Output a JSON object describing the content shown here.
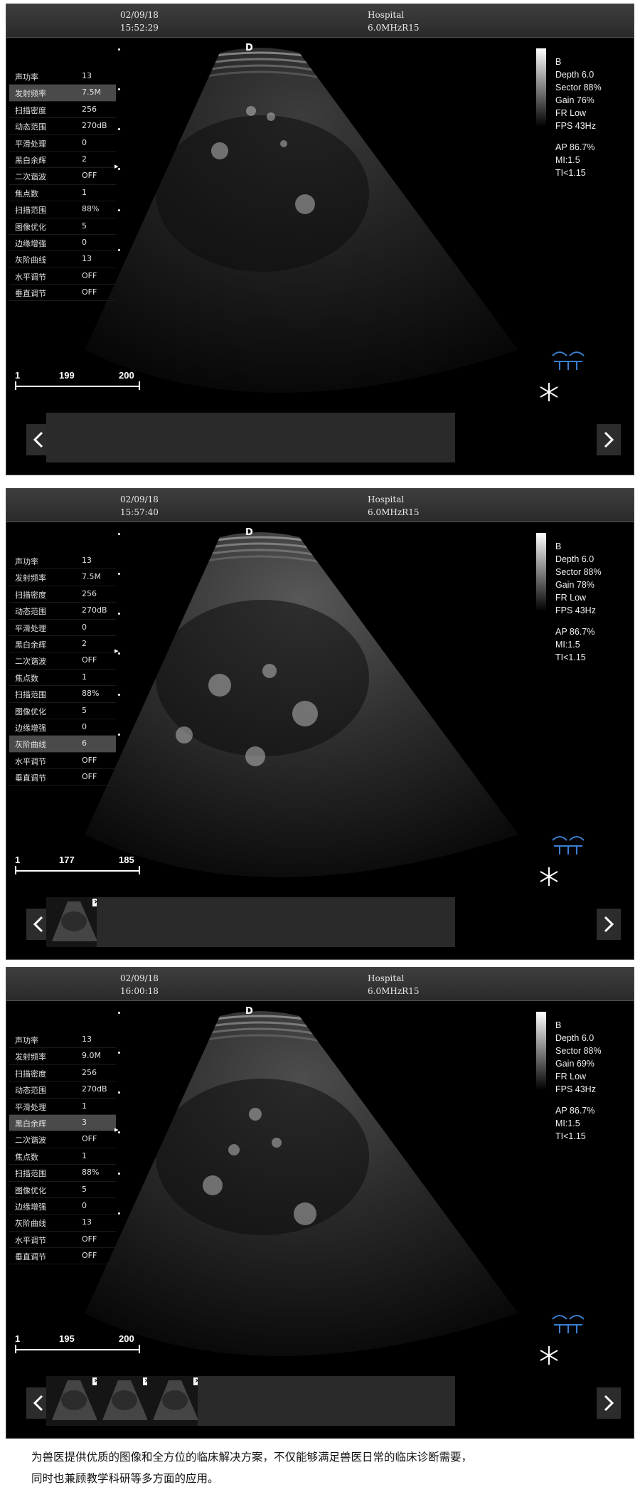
{
  "panels": [
    {
      "date": "02/09/18",
      "time": "15:52:29",
      "hospital": "Hospital",
      "freq": "6.0MHzR15",
      "depth_marker": "D",
      "params": [
        {
          "label": "声功率",
          "value": "13"
        },
        {
          "label": "发射频率",
          "value": "7.5M"
        },
        {
          "label": "扫描密度",
          "value": "256"
        },
        {
          "label": "动态范围",
          "value": "270dB"
        },
        {
          "label": "平滑处理",
          "value": "0"
        },
        {
          "label": "黑白余辉",
          "value": "2"
        },
        {
          "label": "二次谐波",
          "value": "OFF"
        },
        {
          "label": "焦点数",
          "value": "1"
        },
        {
          "label": "扫描范围",
          "value": "88%"
        },
        {
          "label": "图像优化",
          "value": "5"
        },
        {
          "label": "边缘增强",
          "value": "0"
        },
        {
          "label": "灰阶曲线",
          "value": "13"
        },
        {
          "label": "水平调节",
          "value": "OFF"
        },
        {
          "label": "垂直调节",
          "value": "OFF"
        }
      ],
      "selected_param": 1,
      "info": {
        "mode": "B",
        "depth": "Depth 6.0",
        "sector": "Sector 88%",
        "gain": "Gain 76%",
        "fr": "FR Low",
        "fps": "FPS 43Hz",
        "ap": "AP 86.7%",
        "mi": "MI:1.5",
        "ti": "TI<1.15"
      },
      "scale": {
        "start": "1",
        "current": "199",
        "end": "200"
      },
      "thumbnails_filled": 0
    },
    {
      "date": "02/09/18",
      "time": "15:57:40",
      "hospital": "Hospital",
      "freq": "6.0MHzR15",
      "depth_marker": "D",
      "params": [
        {
          "label": "声功率",
          "value": "13"
        },
        {
          "label": "发射频率",
          "value": "7.5M"
        },
        {
          "label": "扫描密度",
          "value": "256"
        },
        {
          "label": "动态范围",
          "value": "270dB"
        },
        {
          "label": "平滑处理",
          "value": "0"
        },
        {
          "label": "黑白余辉",
          "value": "2"
        },
        {
          "label": "二次谐波",
          "value": "OFF"
        },
        {
          "label": "焦点数",
          "value": "1"
        },
        {
          "label": "扫描范围",
          "value": "88%"
        },
        {
          "label": "图像优化",
          "value": "5"
        },
        {
          "label": "边缘增强",
          "value": "0"
        },
        {
          "label": "灰阶曲线",
          "value": "6"
        },
        {
          "label": "水平调节",
          "value": "OFF"
        },
        {
          "label": "垂直调节",
          "value": "OFF"
        }
      ],
      "selected_param": 11,
      "info": {
        "mode": "B",
        "depth": "Depth 6.0",
        "sector": "Sector 88%",
        "gain": "Gain 78%",
        "fr": "FR Low",
        "fps": "FPS 43Hz",
        "ap": "AP 86.7%",
        "mi": "MI:1.5",
        "ti": "TI<1.15"
      },
      "scale": {
        "start": "1",
        "current": "177",
        "end": "185"
      },
      "thumbnails_filled": 1
    },
    {
      "date": "02/09/18",
      "time": "16:00:18",
      "hospital": "Hospital",
      "freq": "6.0MHzR15",
      "depth_marker": "D",
      "params": [
        {
          "label": "声功率",
          "value": "13"
        },
        {
          "label": "发射频率",
          "value": "9.0M"
        },
        {
          "label": "扫描密度",
          "value": "256"
        },
        {
          "label": "动态范围",
          "value": "270dB"
        },
        {
          "label": "平滑处理",
          "value": "1"
        },
        {
          "label": "黑白余辉",
          "value": "3"
        },
        {
          "label": "二次谐波",
          "value": "OFF"
        },
        {
          "label": "焦点数",
          "value": "1"
        },
        {
          "label": "扫描范围",
          "value": "88%"
        },
        {
          "label": "图像优化",
          "value": "5"
        },
        {
          "label": "边缘增强",
          "value": "0"
        },
        {
          "label": "灰阶曲线",
          "value": "13"
        },
        {
          "label": "水平调节",
          "value": "OFF"
        },
        {
          "label": "垂直调节",
          "value": "OFF"
        }
      ],
      "selected_param": 5,
      "info": {
        "mode": "B",
        "depth": "Depth 6.0",
        "sector": "Sector 88%",
        "gain": "Gain 69%",
        "fr": "FR Low",
        "fps": "FPS 43Hz",
        "ap": "AP 86.7%",
        "mi": "MI:1.5",
        "ti": "TI<1.15"
      },
      "scale": {
        "start": "1",
        "current": "195",
        "end": "200"
      },
      "thumbnails_filled": 3
    }
  ],
  "caption": {
    "line1": "为兽医提供优质的图像和全方位的临床解决方案，不仅能够满足兽医日常的临床诊断需要，",
    "line2": "同时也兼顾教学科研等多方面的应用。"
  },
  "icons": {
    "prev": "chevron-left-icon",
    "next": "chevron-right-icon",
    "close": "close-icon",
    "probe": "probe-icon",
    "freeze": "freeze-icon"
  }
}
